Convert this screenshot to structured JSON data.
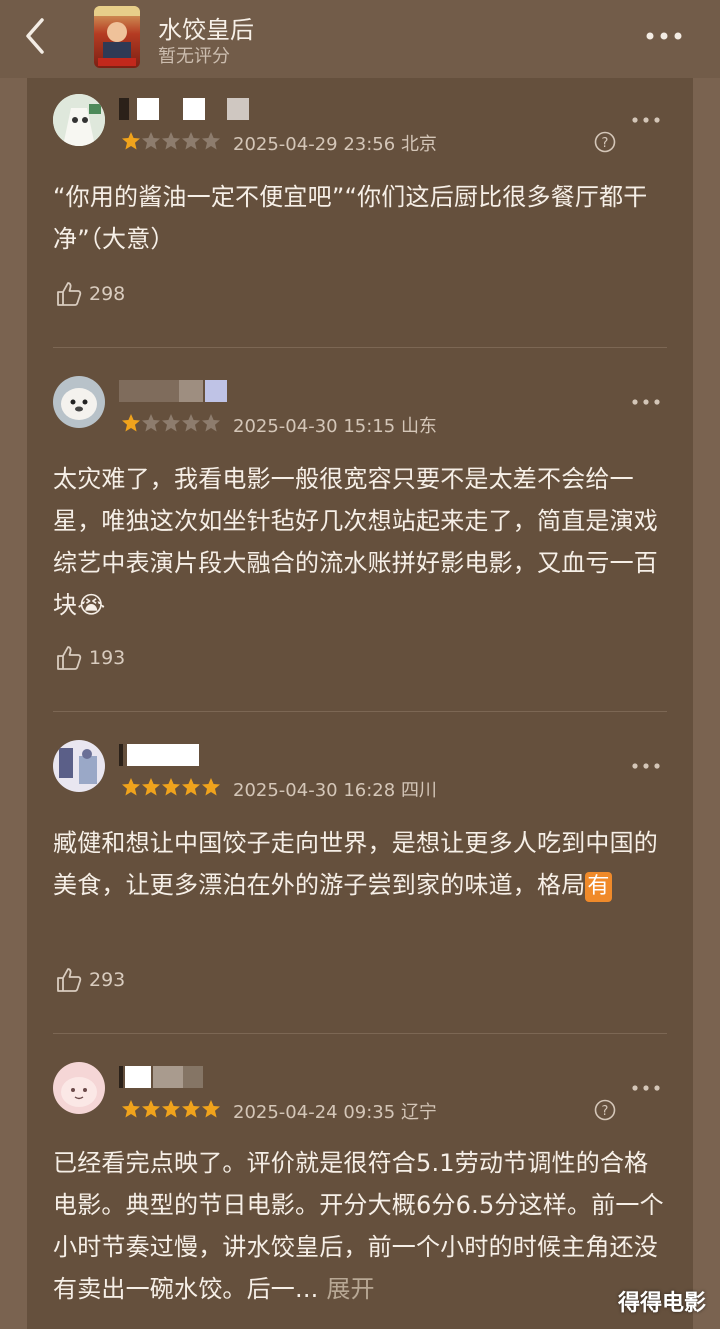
{
  "header": {
    "title": "水饺皇后",
    "score_text": "暂无评分"
  },
  "reviews": [
    {
      "rating": 1,
      "date": "2025-04-29 23:56",
      "location": "北京",
      "text": "“你用的酱油一定不便宜吧”“你们这后厨比很多餐厅都干净”（大意）",
      "likes": "298"
    },
    {
      "rating": 1,
      "date": "2025-04-30 15:15",
      "location": "山东",
      "text": "太灾难了，我看电影一般很宽容只要不是太差不会给一星，唯独这次如坐针毡好几次想站起来走了，简直是演戏综艺中表演片段大融合的流水账拼好影电影，又血亏一百块",
      "emoji": "😭",
      "likes": "193"
    },
    {
      "rating": 5,
      "date": "2025-04-30 16:28",
      "location": "四川",
      "text": "臧健和想让中国饺子走向世界，是想让更多人吃到中国的美食，让更多漂泊在外的游子尝到家的味道，格局",
      "badge": "有",
      "likes": "293"
    },
    {
      "rating": 5,
      "date": "2025-04-24 09:35",
      "location": "辽宁",
      "text": "已经看完点映了。评价就是很符合5.1劳动节调性的合格电影。典型的节日电影。开分大概6分6.5分这样。前一个小时节奏过慢，讲水饺皇后，前一个小时的时候主角还没有卖出一碗水饺。后一...",
      "expand_label": "展开"
    }
  ],
  "watermark": "得得电影",
  "colors": {
    "background": "#7a6350",
    "panel": "#65503d",
    "star_on": "#f0a31c",
    "star_off": "#8d7c6d"
  }
}
